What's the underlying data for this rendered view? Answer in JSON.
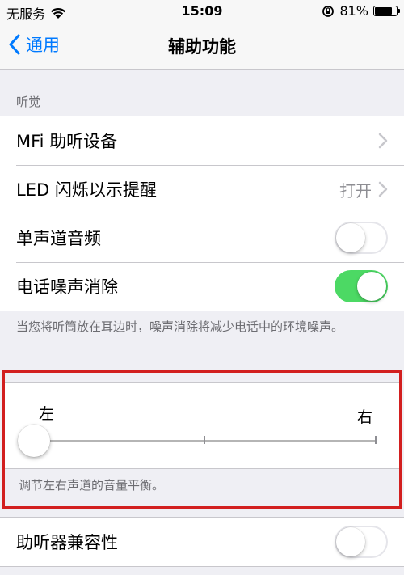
{
  "status": {
    "carrier": "无服务",
    "time": "15:09",
    "battery_percent": "81%",
    "battery_level": 0.81
  },
  "nav": {
    "back_label": "通用",
    "title": "辅助功能"
  },
  "hearing": {
    "header": "听觉",
    "rows": [
      {
        "label": "MFi 助听设备",
        "type": "link"
      },
      {
        "label": "LED 闪烁以示提醒",
        "value": "打开",
        "type": "link"
      },
      {
        "label": "单声道音频",
        "type": "toggle",
        "on": false
      },
      {
        "label": "电话噪声消除",
        "type": "toggle",
        "on": true
      }
    ],
    "footer": "当您将听筒放在耳边时，噪声消除将减少电话中的环境噪声。"
  },
  "balance": {
    "left_label": "左",
    "right_label": "右",
    "value": 0.0,
    "caption": "调节左右声道的音量平衡。"
  },
  "hearing_aid_compat": {
    "label": "助听器兼容性",
    "on": false
  },
  "colors": {
    "accent": "#007aff",
    "toggle_on": "#4cd964",
    "highlight_border": "#d21f1f"
  }
}
